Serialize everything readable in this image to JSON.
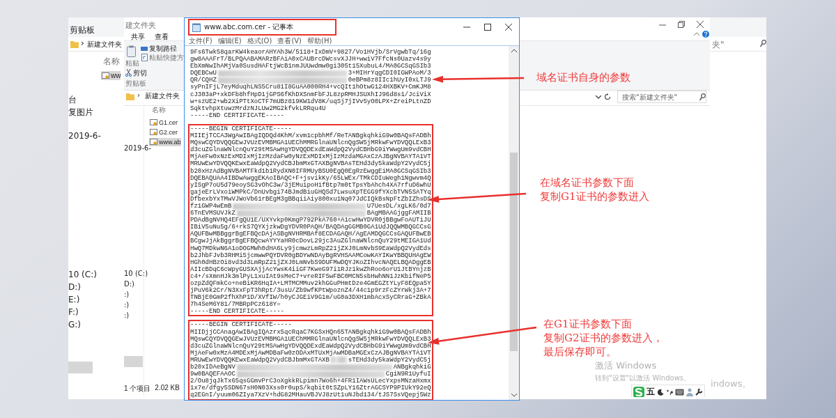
{
  "back_explorer": {
    "ribbon_group": "剪贴板",
    "breadcrumb_separator": "›",
    "breadcrumb": "新建文件夹",
    "column": "名称",
    "files": [
      {
        "name": "ww",
        "selected": true
      }
    ],
    "nav_items": [
      "台",
      "复图片",
      "2019-6-",
      "10 (C:)",
      "D:)",
      "E:)",
      "F:)",
      "G:)"
    ],
    "search_fragment": "夹\"",
    "activation_fragment": "indows。"
  },
  "front_explorer": {
    "title": "建文件夹",
    "tabs": [
      {
        "label": "共享",
        "selected": false
      },
      {
        "label": "查看",
        "selected": false
      }
    ],
    "ribbon": {
      "paste": "粘贴",
      "cut": "剪切",
      "copy_path": "复制路径",
      "paste_shortcut": "粘贴快捷方",
      "group": "剪贴板"
    },
    "breadcrumb_separator": "›",
    "breadcrumb": "新建文件夹",
    "search": {
      "placeholder": "搜索\"新建文件夹\""
    },
    "column": "名称",
    "files": [
      {
        "name": "G1.cer",
        "selected": false
      },
      {
        "name": "G2.cer",
        "selected": false
      },
      {
        "name": "www.ab",
        "selected": true
      }
    ],
    "nav_items": [
      "2019-6-",
      "10 (C:)",
      "D:)",
      ":)",
      ":)",
      ":)"
    ],
    "status_bar": {
      "count": "1 个项目",
      "size": "2.02 KB"
    }
  },
  "notepad": {
    "title": "www.abc.com.cer - 记事本",
    "menu": [
      "文件(F)",
      "编辑(E)",
      "格式(O)",
      "查看(V)",
      "帮助(H)"
    ],
    "blocks": [
      {
        "highlighted": false,
        "lines": [
          {
            "kind": "text",
            "text": "9Fs6Twk58qarKW4keaorAHYAh3W/5118+IxDmV+9827/Vo1HVjb/SrVgwbTq/16g"
          },
          {
            "kind": "text",
            "text": "gw8AAAFrT/BLPQAABAMARzBFAiA0xCAUBrcDWcsvXJJH+wwiV7FfcNs0Uazv4s9y"
          },
          {
            "kind": "text",
            "text": "EbXmNwIhAMjVa0SusdHAFtjWcB1nmJUUwdmw0gi305t15XubuL4/MA0GCSqGSIb3"
          },
          {
            "kind": "redacted",
            "before": "DQEBCwU",
            "after": "3+MIHrYqgCDI0IGWPAoM/3"
          },
          {
            "kind": "redacted",
            "before": "QR/CQHZ",
            "after": "0eBPm8z8IIc1hUyI0xLTJ9"
          },
          {
            "kind": "text",
            "text": "syPnIFjL7eyMduqhLNS5Cru81I8GuAA000RH4+vcQIt1hOtwG124HXBKV+CmKJM8"
          },
          {
            "kind": "text",
            "text": "cJ303aP+xkDFb8hfHpD1jGPS6fKhDXSnmFbFJL8zpRMHJSUXhIJ96d8s1/JciViX"
          },
          {
            "kind": "text",
            "text": "w+szUE2+wb2XiPTtXoCTF7mUBz819KW1dV8K/uqSj7jIVv5yO0LPX+ZreiPLtnZD"
          },
          {
            "kind": "text",
            "text": "SqktvhpXtuwzMrdzNJLUw2MG2kfvkLRRqu4U"
          },
          {
            "kind": "text",
            "text": "-----END CERTIFICATE-----"
          }
        ]
      },
      {
        "highlighted": true,
        "lines": [
          {
            "kind": "text",
            "text": "-----BEGIN CERTIFICATE-----"
          },
          {
            "kind": "text",
            "text": "MIIEjTCCA3WgAwIBAgIQDQd4KhM/xvm1cpbhMf/ReTANBgkqhkiG9w0BAQsFADBh"
          },
          {
            "kind": "text",
            "text": "MQswCQYDVQQGEwJVUzEVMBMGA1UEChMMRGlnaUNlcnQgSW5jMRkwFwYDVQQLExB3"
          },
          {
            "kind": "text",
            "text": "d3cuZGlnaWNlcnQuY29tMSAwHgYDVQQDExdEaWdpQ2VydCBHbG9iYWwgUm9vdCBH"
          },
          {
            "kind": "text",
            "text": "MjAeFw0xNzExMDIxMjIzMzdaFw0yNzExMDIxMjIzMzdaMGAxCzAJBgNVBAYTA1VT"
          },
          {
            "kind": "text",
            "text": "MRUwEwYDVQQKEwxEaWdpQ2VydCBJbmMxGTAXBgNVBAsTEHd3dy5kaWdpY2VydC5j"
          },
          {
            "kind": "text",
            "text": "b20xHzAdBgNVBAMTFkd1b1RydXN0IFRMUyBSU0EgQ0EgRzEwggEiMA0GCSqGSIb3"
          },
          {
            "kind": "text",
            "text": "DQEBAQUAA4IBDwAwggEKAoIBAQC+F+jsvikKy/65LWEx/TMkCDIuWegh1Ngwvm4Q"
          },
          {
            "kind": "text",
            "text": "yISgP7oU5d79eoySG3vOhC3w/3jEMuipoH1fBtp7m0tTpsYbAhch4XA7rfuD6whU"
          },
          {
            "kind": "text",
            "text": "gajeErLVxoiWMPkC/DnUvbgi74BJmdBiuGHQSd7LwsuXpTEGG9fYXcbTVN5SATYq"
          },
          {
            "kind": "text",
            "text": "DfbexbYxTMwVJWoVb61rBEgM3gBBqiiAiy800xu1Nq07JdCIQkBsNpFtZbIZhsDS"
          },
          {
            "kind": "redacted",
            "before": "fz1GWP4wEmB",
            "after": "U7UesDL/xgLK6/0d7"
          },
          {
            "kind": "redacted",
            "before": "6TnEVMSUVJkZ",
            "after": "BAgMBAAGjggFAMIIB"
          },
          {
            "kind": "text",
            "text": "PDAdBgNVHQ4EFgQU1E/UXYvkp0KmgP792PkA760+A1cwHwYDVR0jBBgwFoAUTiJU"
          },
          {
            "kind": "text",
            "text": "IBiV5uNu5g/6+rkS7QYXjzkwDgYDVR0PAQH/BAQDAgGGMB0GA1UdJQQWMBQGCCsG"
          },
          {
            "kind": "text",
            "text": "AQUFBwMBBggrBgEFBQcDAjASBgNVHRMBAf8ECDAGAQH/AgEAMDQGCCsGAQUFBwEB"
          },
          {
            "kind": "text",
            "text": "BCgwJjAkBggrBgEFBQcwAYYYaHR0cDovL29jc3AuZGlnaWNlcnQuY29tMEIGA1Ud"
          },
          {
            "kind": "text",
            "text": "HwQ7MDkwN6A1oDOGMWh0dHA6Ly9jcmwzLmRpZ21jZXJ0LmNvbS9EaWdpQ2VydEds"
          },
          {
            "kind": "text",
            "text": "b2JhbFJvb3RHMi5jcmwwPQYDVR0gBDYwNDAyBgRVHSAAMCowKAYIKwYBBQUHAgEW"
          },
          {
            "kind": "text",
            "text": "HGh0dHBzOi8vd3d3LmRpZ21jZXJ0LmNvbS9DUFMwDQYJKoZIhvcNAQELBQADggEB"
          },
          {
            "kind": "text",
            "text": "AIIcBDqC6cWpyGUSXAjjAcYwsK4iiGF7KweG97i1RJz1kwZhRoo6orU1JtBYnjzB"
          },
          {
            "kind": "text",
            "text": "c4+/sXmnHJk3mlPyL1xuIAt9sMeC7+vreRIF5wFBC0MCN5sbHwhNN1JzKbifNeP5"
          },
          {
            "kind": "text",
            "text": "ozpZdQFmkCo+neBiKR6HqIA+LMTMCMMuv2khGGuPHmtDze4GmEGZtYLyF8EQpa5Y"
          },
          {
            "kind": "text",
            "text": "jPuV6k2Cr/N3XxFpT3hRpt/3usU/Zb9wfKPtWpoznZ4/44c1p9rzFcZYrWkj3A+7"
          },
          {
            "kind": "text",
            "text": "TNBjE0GmP2fhXhP1D/XVfIW/h0yCJGEiV9G1m/uG0a3DXH1mbAcxSyCRraG+ZBkA"
          },
          {
            "kind": "text",
            "text": "7h4SeM6Y81/7MBRpPCz618Y="
          },
          {
            "kind": "text",
            "text": "-----END CERTIFICATE-----"
          }
        ]
      },
      {
        "highlighted": true,
        "lines": [
          {
            "kind": "text",
            "text": "-----BEGIN CERTIFICATE-----"
          },
          {
            "kind": "text",
            "text": "MIIDjjCCAnagAwIBAgIQAzrx5qcRqaC7KGSxHQn65TANBgkqhkiG9w0BAQsFADBh"
          },
          {
            "kind": "text",
            "text": "MQswCQYDVQQGEwJVUzEVMBMGA1UEChMMRGlnaUNlcnQgSW5jMRkwFwYDVQQLExB3"
          },
          {
            "kind": "text",
            "text": "d3cuZGlnaWNlcnQuY29tMSAwHgYDVQQDExdEaWdpQ2VydCBHbG9iYWwgUm9vdCBH"
          },
          {
            "kind": "text",
            "text": "MjAeFw0xMzA4MDExMjAwMDBaFw0zODAxMTUxMjAwMDBaMGExCzAJBgNVBAYTA1VT"
          },
          {
            "kind": "redacted",
            "before": "MRUwEwYDVQQKEwxEaWdpQ2VydCBJbmMxGTAXB",
            "after": "sTEHd3dy5kaWdpY2VydC5j"
          },
          {
            "kind": "redacted",
            "before": "b20xIDAeBgNV",
            "after": "ANBgkqhkiG"
          },
          {
            "kind": "redacted",
            "before": "9w0BAQEFAAOC",
            "after": "CgiN9R1UyfuI"
          },
          {
            "kind": "text",
            "text": "2/Ou8jqJkTx65qsGGmvPrC3oXgkkRLpimn7Wo6h+4FR1IAWsULecYxpsMNzaHxmx"
          },
          {
            "kind": "text",
            "text": "1x7e/dfgy5SDN67sH0N03Xss0r0upS/kqbit0tSZpLY16ZtrAGCSYP9PIUkY92eQ"
          },
          {
            "kind": "text",
            "text": "q2EGnI/yuum06ZIya7XzV+hdG82MHauVBJVJ8zUt1uNJbd134/tJS7SsVQepj5Wz"
          }
        ]
      }
    ]
  },
  "annotations": [
    {
      "lines": [
        "域名证书自身的参数"
      ]
    },
    {
      "lines": [
        "在域名证书参数下面",
        "复制G1证书的参数进入"
      ]
    },
    {
      "lines": [
        "在G1证书参数下面",
        "复制G2证书的参数进入，",
        "最后保存即可。"
      ]
    }
  ],
  "activation": {
    "title": "激活 Windows",
    "subtitle": "转到\"设置\"以激活 Windows。"
  },
  "ime_toolbar": {
    "mode": "五"
  }
}
